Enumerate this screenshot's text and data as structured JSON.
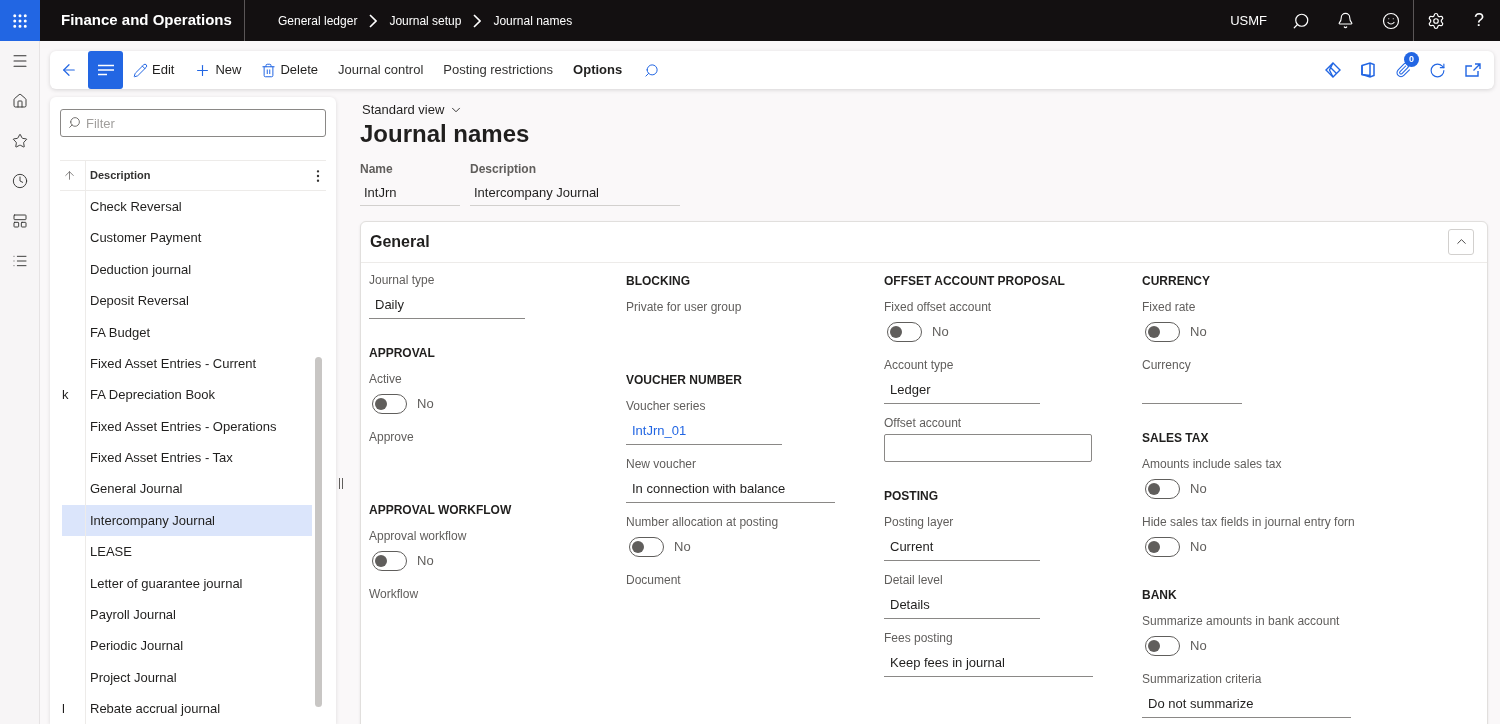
{
  "top_bar": {
    "app_title": "Finance and Operations",
    "breadcrumb": [
      "General ledger",
      "Journal setup",
      "Journal names"
    ],
    "company": "USMF",
    "help": "?"
  },
  "action_pane": {
    "buttons": [
      {
        "kind": "edit",
        "label": "Edit"
      },
      {
        "kind": "new",
        "label": "New"
      },
      {
        "kind": "delete",
        "label": "Delete"
      }
    ],
    "tabs": [
      {
        "label": "Journal control",
        "selected": false
      },
      {
        "label": "Posting restrictions",
        "selected": false
      },
      {
        "label": "Options",
        "selected": true
      }
    ],
    "attachments_badge": "0"
  },
  "list_panel": {
    "filter": {
      "placeholder": "Filter"
    },
    "column_header": "Description",
    "rows": [
      {
        "description": "Check Reversal",
        "selected": false
      },
      {
        "description": "Customer Payment",
        "selected": false
      },
      {
        "description": "Deduction journal",
        "selected": false
      },
      {
        "description": "Deposit Reversal",
        "selected": false
      },
      {
        "description": "FA Budget",
        "selected": false
      },
      {
        "description": "Fixed Asset Entries - Current",
        "selected": false
      },
      {
        "column_1": "k",
        "description": "FA Depreciation Book",
        "selected": false
      },
      {
        "description": "Fixed Asset Entries - Operations",
        "selected": false
      },
      {
        "description": "Fixed Asset Entries - Tax",
        "selected": false
      },
      {
        "description": "General Journal",
        "selected": false
      },
      {
        "description": "Intercompany Journal",
        "selected": true
      },
      {
        "description": "LEASE",
        "selected": false
      },
      {
        "description": "Letter of guarantee journal",
        "selected": false
      },
      {
        "description": "Payroll Journal",
        "selected": false
      },
      {
        "description": "Periodic Journal",
        "selected": false
      },
      {
        "description": "Project Journal",
        "selected": false
      },
      {
        "column_1": "l",
        "description": "Rebate accrual journal",
        "selected": false
      }
    ]
  },
  "form": {
    "view_selector": "Standard view",
    "title": "Journal names",
    "header_fields": [
      {
        "label": "Name",
        "value": "IntJrn"
      },
      {
        "label": "Description",
        "value": "Intercompany Journal"
      }
    ],
    "section": {
      "title": "General",
      "expanded": true,
      "columns": [
        [
          {
            "kind": "field",
            "label": "Journal type",
            "value": "Daily"
          },
          {
            "kind": "heading",
            "text": "APPROVAL"
          },
          {
            "kind": "toggle",
            "label": "Active",
            "on": false,
            "value": "No"
          },
          {
            "kind": "label",
            "label": "Approve"
          },
          {
            "kind": "heading",
            "text": "APPROVAL WORKFLOW"
          },
          {
            "kind": "toggle",
            "label": "Approval workflow",
            "on": false,
            "value": "No"
          },
          {
            "kind": "label",
            "label": "Workflow"
          }
        ],
        [
          {
            "kind": "heading",
            "text": "BLOCKING"
          },
          {
            "kind": "label",
            "label": "Private for user group"
          },
          {
            "kind": "heading",
            "text": "VOUCHER NUMBER"
          },
          {
            "kind": "link",
            "label": "Voucher series",
            "value": "IntJrn_01"
          },
          {
            "kind": "field",
            "label": "New voucher",
            "value": "In connection with balance"
          },
          {
            "kind": "toggle",
            "label": "Number allocation at posting",
            "on": false,
            "value": "No"
          },
          {
            "kind": "label",
            "label": "Document"
          }
        ],
        [
          {
            "kind": "heading",
            "text": "OFFSET ACCOUNT PROPOSAL"
          },
          {
            "kind": "toggle",
            "label": "Fixed offset account",
            "on": false,
            "value": "No"
          },
          {
            "kind": "field",
            "label": "Account type",
            "value": "Ledger"
          },
          {
            "kind": "input",
            "label": "Offset account"
          },
          {
            "kind": "heading",
            "text": "POSTING"
          },
          {
            "kind": "field",
            "label": "Posting layer",
            "value": "Current"
          },
          {
            "kind": "field",
            "label": "Detail level",
            "value": "Details"
          },
          {
            "kind": "field",
            "label": "Fees posting",
            "value": "Keep fees in journal"
          }
        ],
        [
          {
            "kind": "heading",
            "text": "CURRENCY"
          },
          {
            "kind": "toggle",
            "label": "Fixed rate",
            "on": false,
            "value": "No"
          },
          {
            "kind": "field",
            "label": "Currency"
          },
          {
            "kind": "heading",
            "text": "SALES TAX"
          },
          {
            "kind": "toggle",
            "label": "Amounts include sales tax",
            "on": false,
            "value": "No"
          },
          {
            "kind": "toggle",
            "label": "Hide sales tax fields in journal entry forn",
            "on": false,
            "value": "No"
          },
          {
            "kind": "heading",
            "text": "BANK"
          },
          {
            "kind": "toggle",
            "label": "Summarize amounts in bank account",
            "on": false,
            "value": "No"
          },
          {
            "kind": "field",
            "label": "Summarization criteria",
            "value": "Do not summarize"
          }
        ]
      ]
    }
  }
}
